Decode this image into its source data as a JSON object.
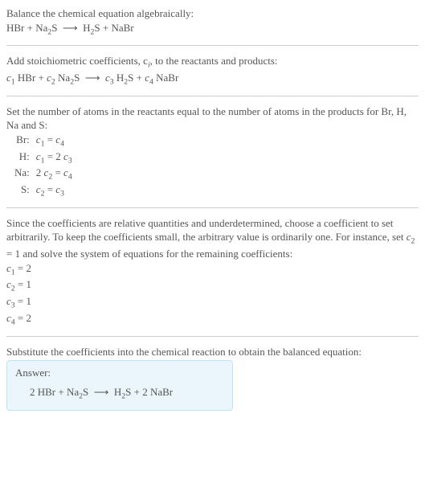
{
  "title": "Balance the chemical equation algebraically:",
  "unbalanced_equation_html": "HBr + Na<sub>2</sub>S &nbsp;⟶&nbsp; H<sub>2</sub>S + NaBr",
  "step_add_coeffs": "Add stoichiometric coefficients, c<sub><i>i</i></sub>, to the reactants and products:",
  "coeff_equation_html": "<i>c</i><sub>1</sub> HBr + <i>c</i><sub>2</sub> Na<sub>2</sub>S &nbsp;⟶&nbsp; <i>c</i><sub>3</sub> H<sub>2</sub>S + <i>c</i><sub>4</sub> NaBr",
  "step_atom_balance": "Set the number of atoms in the reactants equal to the number of atoms in the products for Br, H, Na and S:",
  "atom_rows": [
    {
      "element": "Br:",
      "equation_html": "<i>c</i><sub>1</sub> = <i>c</i><sub>4</sub>"
    },
    {
      "element": "H:",
      "equation_html": "<i>c</i><sub>1</sub> = 2 <i>c</i><sub>3</sub>"
    },
    {
      "element": "Na:",
      "equation_html": "2 <i>c</i><sub>2</sub> = <i>c</i><sub>4</sub>"
    },
    {
      "element": "S:",
      "equation_html": "<i>c</i><sub>2</sub> = <i>c</i><sub>3</sub>"
    }
  ],
  "step_underdetermined": "Since the coefficients are relative quantities and underdetermined, choose a coefficient to set arbitrarily. To keep the coefficients small, the arbitrary value is ordinarily one. For instance, set <i>c</i><sub>2</sub> = 1 and solve the system of equations for the remaining coefficients:",
  "solved": [
    "<i>c</i><sub>1</sub> = 2",
    "<i>c</i><sub>2</sub> = 1",
    "<i>c</i><sub>3</sub> = 1",
    "<i>c</i><sub>4</sub> = 2"
  ],
  "step_substitute": "Substitute the coefficients into the chemical reaction to obtain the balanced equation:",
  "answer_label": "Answer:",
  "balanced_equation_html": "2 HBr + Na<sub>2</sub>S &nbsp;⟶&nbsp; H<sub>2</sub>S + 2 NaBr"
}
